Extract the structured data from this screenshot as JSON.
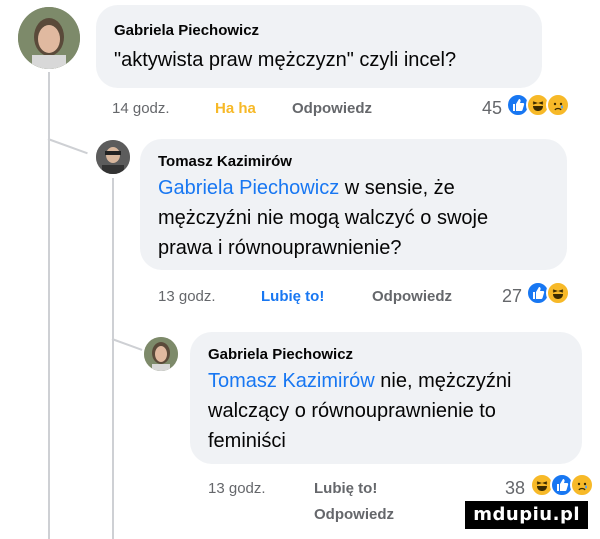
{
  "comments": [
    {
      "author": "Gabriela Piechowicz",
      "text": "\"aktywista praw mężczyzn\" czyli incel?",
      "time": "14 godz.",
      "reaction_label": "Ha ha",
      "reply_label": "Odpowiedz",
      "count": "45",
      "reactions": [
        "like-icon",
        "haha-icon",
        "sad-icon"
      ]
    },
    {
      "author": "Tomasz Kazimirów",
      "mention": "Gabriela Piechowicz",
      "text_line1_rest": " w sensie, że",
      "text_line2": "mężczyźni nie mogą walczyć o swoje",
      "text_line3": "prawa i równouprawnienie?",
      "time": "13 godz.",
      "reaction_label": "Lubię to!",
      "reply_label": "Odpowiedz",
      "count": "27",
      "reactions": [
        "like-icon",
        "haha-icon"
      ]
    },
    {
      "author": "Gabriela Piechowicz",
      "mention": "Tomasz Kazimirów",
      "text_line1_rest": " nie, mężczyźni",
      "text_line2": "walczący o równouprawnienie to",
      "text_line3": "feminiści",
      "time": "13 godz.",
      "reaction_label": "Lubię to!",
      "reply_label": "Odpowiedz",
      "count": "38",
      "reactions": [
        "haha-icon",
        "like-icon",
        "sad-icon"
      ]
    }
  ],
  "watermark": "mdupiu.pl",
  "colors": {
    "bubble": "#f0f2f5",
    "link": "#1877f2",
    "haha": "#f7b928",
    "meta": "#65676b"
  }
}
